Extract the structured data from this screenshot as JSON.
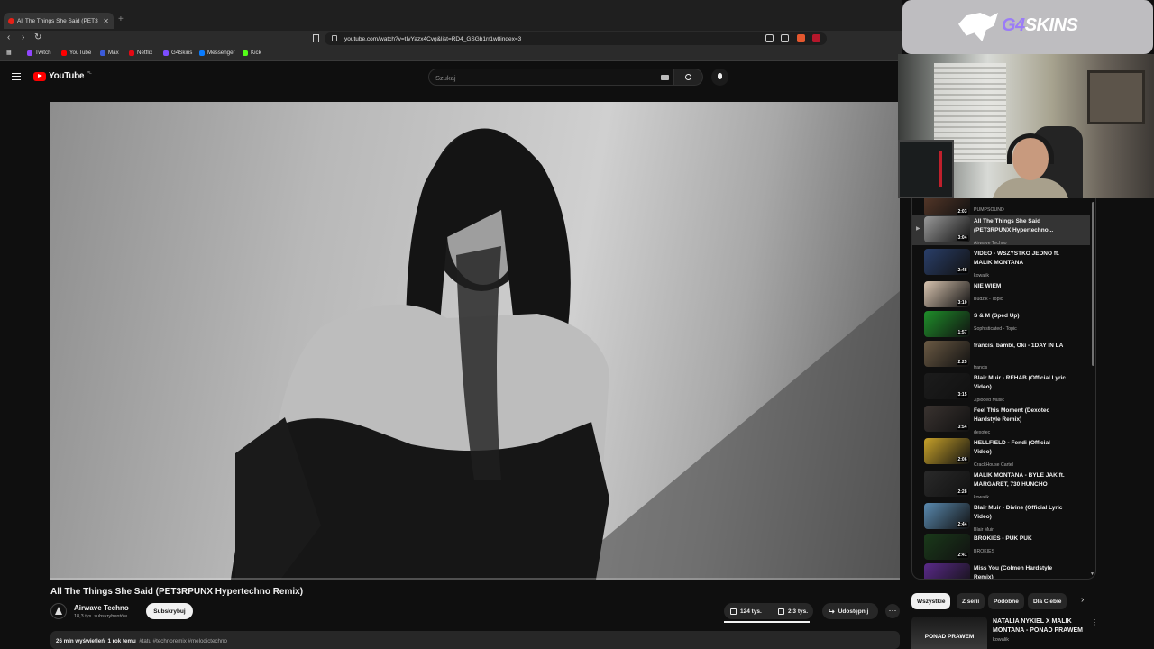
{
  "browser": {
    "tab_title": "All The Things She Said (PET3",
    "url": "youtube.com/watch?v=tIvYazx4Cvg&list=RD4_GSGb1rr1w8index=3",
    "bookmarks": [
      {
        "label": "Twitch",
        "color": "#9146ff"
      },
      {
        "label": "YouTube",
        "color": "#ff0000"
      },
      {
        "label": "Max",
        "color": "#3b5bdb"
      },
      {
        "label": "Netflix",
        "color": "#e50914"
      },
      {
        "label": "G4Skins",
        "color": "#7c4dff"
      },
      {
        "label": "Messenger",
        "color": "#0a7cff"
      },
      {
        "label": "Kick",
        "color": "#53fc18"
      }
    ]
  },
  "masthead": {
    "logo_text": "YouTube",
    "country": "PL",
    "search_placeholder": "Szukaj"
  },
  "video": {
    "title": "All The Things She Said (PET3RPUNX Hypertechno Remix)",
    "channel": "Airwave Techno",
    "subscribers": "18,3 tys. subskrybentów",
    "subscribe_label": "Subskrybuj",
    "likes": "124 tys.",
    "dislikes": "2,3 tys.",
    "share_label": "Udostępnij",
    "views": "26 mln wyświetleń",
    "age": "1 rok temu",
    "hashtags": "#tatu #technoremix #melodictechno",
    "progress": 0
  },
  "overlay": {
    "brand_part1": "G4",
    "brand_part2": "SKINS",
    "brand_accent": "#9b7cf7"
  },
  "playlist": {
    "items": [
      {
        "title": "(PUMPSOUND Remix)",
        "channel": "PUMPSOUND",
        "duration": "2:03",
        "active": false,
        "thumb": "#5a3a2a"
      },
      {
        "title": "All The Things She Said (PET3RPUNX Hypertechno...",
        "channel": "Airwave Techno",
        "duration": "3:04",
        "active": true,
        "thumb": "#9a9a9a"
      },
      {
        "title": "VIDEO - WSZYSTKO JEDNO ft. MALIK MONTANA",
        "channel": "kowalik",
        "duration": "2:48",
        "active": false,
        "thumb": "#2a3f6a"
      },
      {
        "title": "NIE WIEM",
        "channel": "Budzik - Topic",
        "duration": "3:10",
        "active": false,
        "thumb": "#d8c4b0"
      },
      {
        "title": "S & M (Sped Up)",
        "channel": "Sophisticated - Topic",
        "duration": "1:57",
        "active": false,
        "thumb": "#1f8f2a"
      },
      {
        "title": "francis, bambi, Oki - 1DAY IN LA",
        "channel": "francis",
        "duration": "2:25",
        "active": false,
        "thumb": "#6b5a44"
      },
      {
        "title": "Blair Muir - REHAB (Official Lyric Video)",
        "channel": "Xploded Music",
        "duration": "3:15",
        "active": false,
        "thumb": "#1c1c1c"
      },
      {
        "title": "Feel This Moment (Dexotec Hardstyle Remix)",
        "channel": "dexotec",
        "duration": "3:54",
        "active": false,
        "thumb": "#3a3330"
      },
      {
        "title": "HELLFIELD - Fendi (Official Video)",
        "channel": "CrackHouse Cartel",
        "duration": "2:06",
        "active": false,
        "thumb": "#c8a22a"
      },
      {
        "title": "MALIK MONTANA - BYLE JAK ft. MARGARET, 730 HUNCHO",
        "channel": "kowalik",
        "duration": "2:28",
        "active": false,
        "thumb": "#2a2a2a"
      },
      {
        "title": "Blair Muir - Divine (Official Lyric Video)",
        "channel": "Blair Muir",
        "duration": "2:44",
        "active": false,
        "thumb": "#5a8ab0"
      },
      {
        "title": "BROKIES - PUK PUK",
        "channel": "BROKIES",
        "duration": "2:41",
        "active": false,
        "thumb": "#1a3a1a"
      },
      {
        "title": "Miss You (Colmen Hardstyle Remix)",
        "channel": "",
        "duration": "",
        "active": false,
        "thumb": "#5a2a8a"
      }
    ]
  },
  "chips": [
    "Wszystkie",
    "Z serii",
    "Podobne",
    "Dla Ciebie"
  ],
  "recommendation": {
    "thumb_text": "PONAD PRAWEM",
    "title": "NATALIA NYKIEL X MALIK MONTANA - PONAD PRAWEM",
    "channel": "kowalik"
  }
}
